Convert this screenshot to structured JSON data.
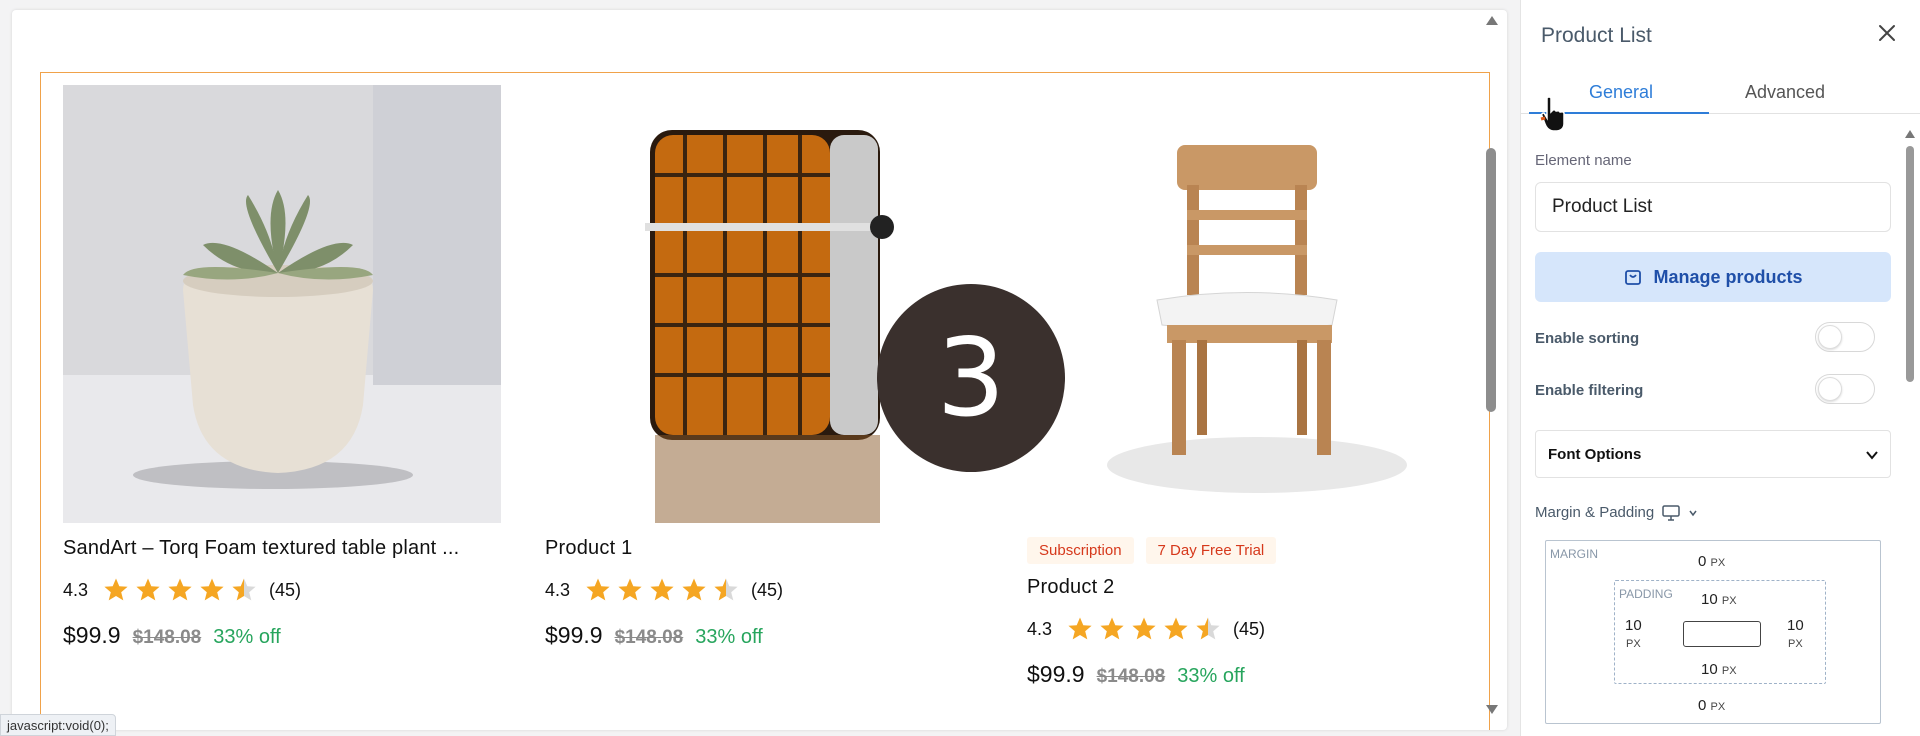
{
  "canvas": {
    "products": [
      {
        "title": "SandArt – Torq Foam textured table plant ...",
        "rating": "4.3",
        "stars": 4.5,
        "review_count": "(45)",
        "price": "$99.9",
        "old_price": "$148.08",
        "discount": "33% off",
        "image": "succulent-plant-image"
      },
      {
        "title": "Product 1",
        "rating": "4.3",
        "stars": 4.5,
        "review_count": "(45)",
        "price": "$99.9",
        "old_price": "$148.08",
        "discount": "33% off",
        "image": "lighter-image"
      },
      {
        "title": "Product 2",
        "badges": [
          "Subscription",
          "7 Day Free Trial"
        ],
        "rating": "4.3",
        "stars": 4.5,
        "review_count": "(45)",
        "price": "$99.9",
        "old_price": "$148.08",
        "discount": "33% off",
        "image": "chair-image"
      }
    ],
    "step_marker": "3",
    "status_bar": "javascript:void(0);"
  },
  "panel": {
    "title": "Product List",
    "tabs": [
      {
        "label": "General",
        "active": true
      },
      {
        "label": "Advanced",
        "active": false
      }
    ],
    "element_name_label": "Element name",
    "element_name_value": "Product List",
    "manage_products_label": "Manage products",
    "enable_sorting_label": "Enable sorting",
    "enable_sorting_on": false,
    "enable_filtering_label": "Enable filtering",
    "enable_filtering_on": false,
    "font_options_label": "Font Options",
    "margin_padding_label": "Margin & Padding",
    "box_model": {
      "margin_label": "MARGIN",
      "padding_label": "PADDING",
      "margin_top": "0",
      "margin_bottom": "0",
      "padding_top": "10",
      "padding_bottom": "10",
      "padding_left": "10",
      "padding_right": "10",
      "unit": "PX"
    }
  },
  "colors": {
    "accent": "#2e7dd8",
    "star": "#f5a623",
    "discount": "#27a55d",
    "badge_text": "#d6381b",
    "selection_border": "#f0a24a"
  }
}
